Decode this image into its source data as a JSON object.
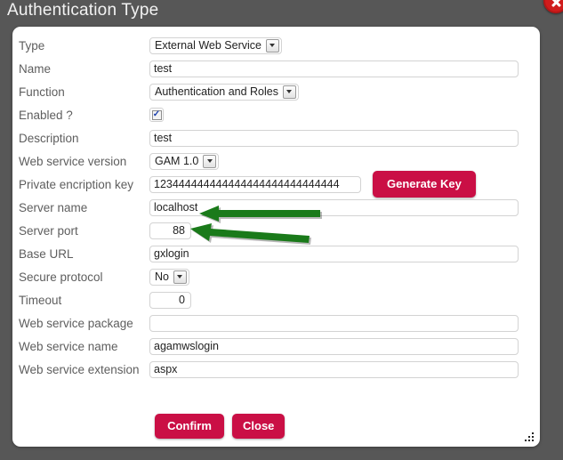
{
  "dialog": {
    "title": "Authentication Type",
    "close_badge_icon": "close-circle-icon",
    "resize_grip_icon": "resize-grip-icon"
  },
  "form": {
    "rows": [
      {
        "label": "Type",
        "kind": "select",
        "value": "External Web Service"
      },
      {
        "label": "Name",
        "kind": "text",
        "value": "test"
      },
      {
        "label": "Function",
        "kind": "select",
        "value": "Authentication and Roles"
      },
      {
        "label": "Enabled ?",
        "kind": "checkbox",
        "value": "checked",
        "check_glyph": "✓"
      },
      {
        "label": "Description",
        "kind": "text",
        "value": "test"
      },
      {
        "label": "Web service version",
        "kind": "select",
        "value": "GAM 1.0"
      },
      {
        "label": "Private encription key",
        "kind": "key",
        "value": "123444444444444444444444444444"
      },
      {
        "label": "Server name",
        "kind": "text",
        "value": "localhost"
      },
      {
        "label": "Server port",
        "kind": "number",
        "value": "88"
      },
      {
        "label": "Base URL",
        "kind": "text",
        "value": "gxlogin"
      },
      {
        "label": "Secure protocol",
        "kind": "select",
        "value": "No"
      },
      {
        "label": "Timeout",
        "kind": "number",
        "value": "0"
      },
      {
        "label": "Web service package",
        "kind": "text",
        "value": ""
      },
      {
        "label": "Web service name",
        "kind": "text",
        "value": "agamwslogin"
      },
      {
        "label": "Web service extension",
        "kind": "text",
        "value": "aspx"
      }
    ]
  },
  "buttons": {
    "generate_key": "Generate Key",
    "confirm": "Confirm",
    "close": "Close"
  },
  "annotations": [
    {
      "name": "arrow-server-name",
      "direction": "left"
    },
    {
      "name": "arrow-server-port",
      "direction": "left"
    }
  ],
  "colors": {
    "backdrop": "#575757",
    "panel": "#ffffff",
    "accent_red": "#ca0f45",
    "badge_red": "#d01c1c",
    "label_gray": "#5e5e5e",
    "arrow_green": "#1a7a1a"
  }
}
